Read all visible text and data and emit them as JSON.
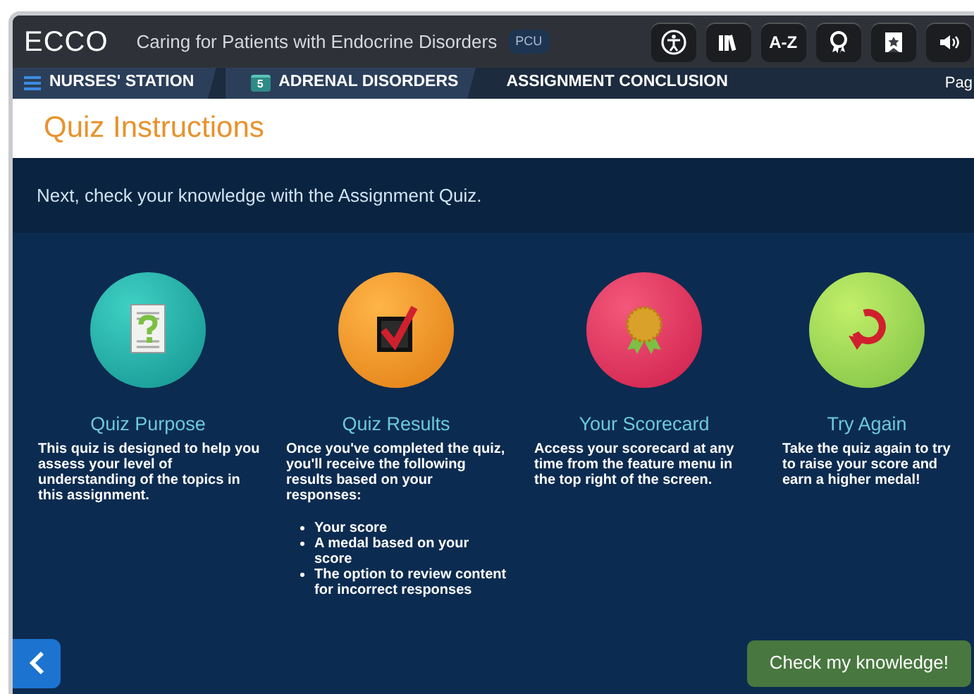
{
  "header": {
    "logo": "ECCO",
    "course": "Caring for Patients with Endocrine Disorders",
    "unit_badge": "PCU",
    "tools": [
      {
        "kind": "accessibility"
      },
      {
        "kind": "books"
      },
      {
        "kind": "text",
        "label": "A-Z"
      },
      {
        "kind": "medal"
      },
      {
        "kind": "bookmark"
      },
      {
        "kind": "sound"
      }
    ]
  },
  "breadcrumb": [
    {
      "kind": "menu",
      "label": "NURSES' STATION"
    },
    {
      "kind": "day",
      "day": "5",
      "label": "ADRENAL DISORDERS"
    },
    {
      "kind": "plain",
      "label": "ASSIGNMENT CONCLUSION"
    }
  ],
  "page_label": "Pag",
  "title": "Quiz Instructions",
  "intro": "Next, check your knowledge with the Assignment Quiz.",
  "cards": [
    {
      "kind": "document",
      "title": "Quiz Purpose",
      "text": "This quiz is designed to help you assess your level of understanding of the topics in this assignment."
    },
    {
      "kind": "checkbox",
      "title": "Quiz Results",
      "text": "Once you've completed the quiz, you'll receive the following results based on your responses:",
      "bullets": [
        "Your score",
        "A medal based on your score",
        "The option to review content for incorrect responses"
      ]
    },
    {
      "kind": "medal",
      "title": "Your Scorecard",
      "text": "Access your scorecard at any time from the feature menu in the top right of the screen."
    },
    {
      "kind": "retry",
      "title": "Try Again",
      "text": "Take the quiz again to try to raise your score and earn a higher medal!"
    }
  ],
  "back_button": {
    "kind": "back"
  },
  "check_button": "Check my knowledge!"
}
